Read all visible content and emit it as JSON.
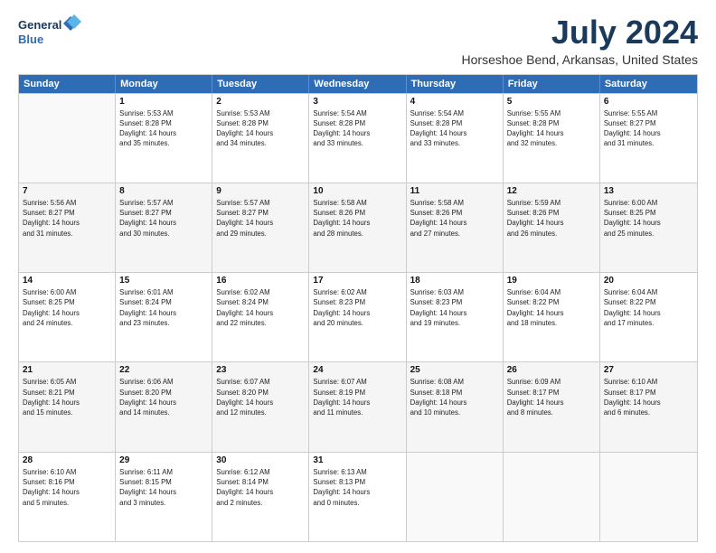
{
  "logo": {
    "line1": "General",
    "line2": "Blue"
  },
  "title": "July 2024",
  "subtitle": "Horseshoe Bend, Arkansas, United States",
  "header_days": [
    "Sunday",
    "Monday",
    "Tuesday",
    "Wednesday",
    "Thursday",
    "Friday",
    "Saturday"
  ],
  "weeks": [
    {
      "shade": false,
      "cells": [
        {
          "day": "",
          "info": ""
        },
        {
          "day": "1",
          "info": "Sunrise: 5:53 AM\nSunset: 8:28 PM\nDaylight: 14 hours\nand 35 minutes."
        },
        {
          "day": "2",
          "info": "Sunrise: 5:53 AM\nSunset: 8:28 PM\nDaylight: 14 hours\nand 34 minutes."
        },
        {
          "day": "3",
          "info": "Sunrise: 5:54 AM\nSunset: 8:28 PM\nDaylight: 14 hours\nand 33 minutes."
        },
        {
          "day": "4",
          "info": "Sunrise: 5:54 AM\nSunset: 8:28 PM\nDaylight: 14 hours\nand 33 minutes."
        },
        {
          "day": "5",
          "info": "Sunrise: 5:55 AM\nSunset: 8:28 PM\nDaylight: 14 hours\nand 32 minutes."
        },
        {
          "day": "6",
          "info": "Sunrise: 5:55 AM\nSunset: 8:27 PM\nDaylight: 14 hours\nand 31 minutes."
        }
      ]
    },
    {
      "shade": true,
      "cells": [
        {
          "day": "7",
          "info": "Sunrise: 5:56 AM\nSunset: 8:27 PM\nDaylight: 14 hours\nand 31 minutes."
        },
        {
          "day": "8",
          "info": "Sunrise: 5:57 AM\nSunset: 8:27 PM\nDaylight: 14 hours\nand 30 minutes."
        },
        {
          "day": "9",
          "info": "Sunrise: 5:57 AM\nSunset: 8:27 PM\nDaylight: 14 hours\nand 29 minutes."
        },
        {
          "day": "10",
          "info": "Sunrise: 5:58 AM\nSunset: 8:26 PM\nDaylight: 14 hours\nand 28 minutes."
        },
        {
          "day": "11",
          "info": "Sunrise: 5:58 AM\nSunset: 8:26 PM\nDaylight: 14 hours\nand 27 minutes."
        },
        {
          "day": "12",
          "info": "Sunrise: 5:59 AM\nSunset: 8:26 PM\nDaylight: 14 hours\nand 26 minutes."
        },
        {
          "day": "13",
          "info": "Sunrise: 6:00 AM\nSunset: 8:25 PM\nDaylight: 14 hours\nand 25 minutes."
        }
      ]
    },
    {
      "shade": false,
      "cells": [
        {
          "day": "14",
          "info": "Sunrise: 6:00 AM\nSunset: 8:25 PM\nDaylight: 14 hours\nand 24 minutes."
        },
        {
          "day": "15",
          "info": "Sunrise: 6:01 AM\nSunset: 8:24 PM\nDaylight: 14 hours\nand 23 minutes."
        },
        {
          "day": "16",
          "info": "Sunrise: 6:02 AM\nSunset: 8:24 PM\nDaylight: 14 hours\nand 22 minutes."
        },
        {
          "day": "17",
          "info": "Sunrise: 6:02 AM\nSunset: 8:23 PM\nDaylight: 14 hours\nand 20 minutes."
        },
        {
          "day": "18",
          "info": "Sunrise: 6:03 AM\nSunset: 8:23 PM\nDaylight: 14 hours\nand 19 minutes."
        },
        {
          "day": "19",
          "info": "Sunrise: 6:04 AM\nSunset: 8:22 PM\nDaylight: 14 hours\nand 18 minutes."
        },
        {
          "day": "20",
          "info": "Sunrise: 6:04 AM\nSunset: 8:22 PM\nDaylight: 14 hours\nand 17 minutes."
        }
      ]
    },
    {
      "shade": true,
      "cells": [
        {
          "day": "21",
          "info": "Sunrise: 6:05 AM\nSunset: 8:21 PM\nDaylight: 14 hours\nand 15 minutes."
        },
        {
          "day": "22",
          "info": "Sunrise: 6:06 AM\nSunset: 8:20 PM\nDaylight: 14 hours\nand 14 minutes."
        },
        {
          "day": "23",
          "info": "Sunrise: 6:07 AM\nSunset: 8:20 PM\nDaylight: 14 hours\nand 12 minutes."
        },
        {
          "day": "24",
          "info": "Sunrise: 6:07 AM\nSunset: 8:19 PM\nDaylight: 14 hours\nand 11 minutes."
        },
        {
          "day": "25",
          "info": "Sunrise: 6:08 AM\nSunset: 8:18 PM\nDaylight: 14 hours\nand 10 minutes."
        },
        {
          "day": "26",
          "info": "Sunrise: 6:09 AM\nSunset: 8:17 PM\nDaylight: 14 hours\nand 8 minutes."
        },
        {
          "day": "27",
          "info": "Sunrise: 6:10 AM\nSunset: 8:17 PM\nDaylight: 14 hours\nand 6 minutes."
        }
      ]
    },
    {
      "shade": false,
      "cells": [
        {
          "day": "28",
          "info": "Sunrise: 6:10 AM\nSunset: 8:16 PM\nDaylight: 14 hours\nand 5 minutes."
        },
        {
          "day": "29",
          "info": "Sunrise: 6:11 AM\nSunset: 8:15 PM\nDaylight: 14 hours\nand 3 minutes."
        },
        {
          "day": "30",
          "info": "Sunrise: 6:12 AM\nSunset: 8:14 PM\nDaylight: 14 hours\nand 2 minutes."
        },
        {
          "day": "31",
          "info": "Sunrise: 6:13 AM\nSunset: 8:13 PM\nDaylight: 14 hours\nand 0 minutes."
        },
        {
          "day": "",
          "info": ""
        },
        {
          "day": "",
          "info": ""
        },
        {
          "day": "",
          "info": ""
        }
      ]
    }
  ]
}
